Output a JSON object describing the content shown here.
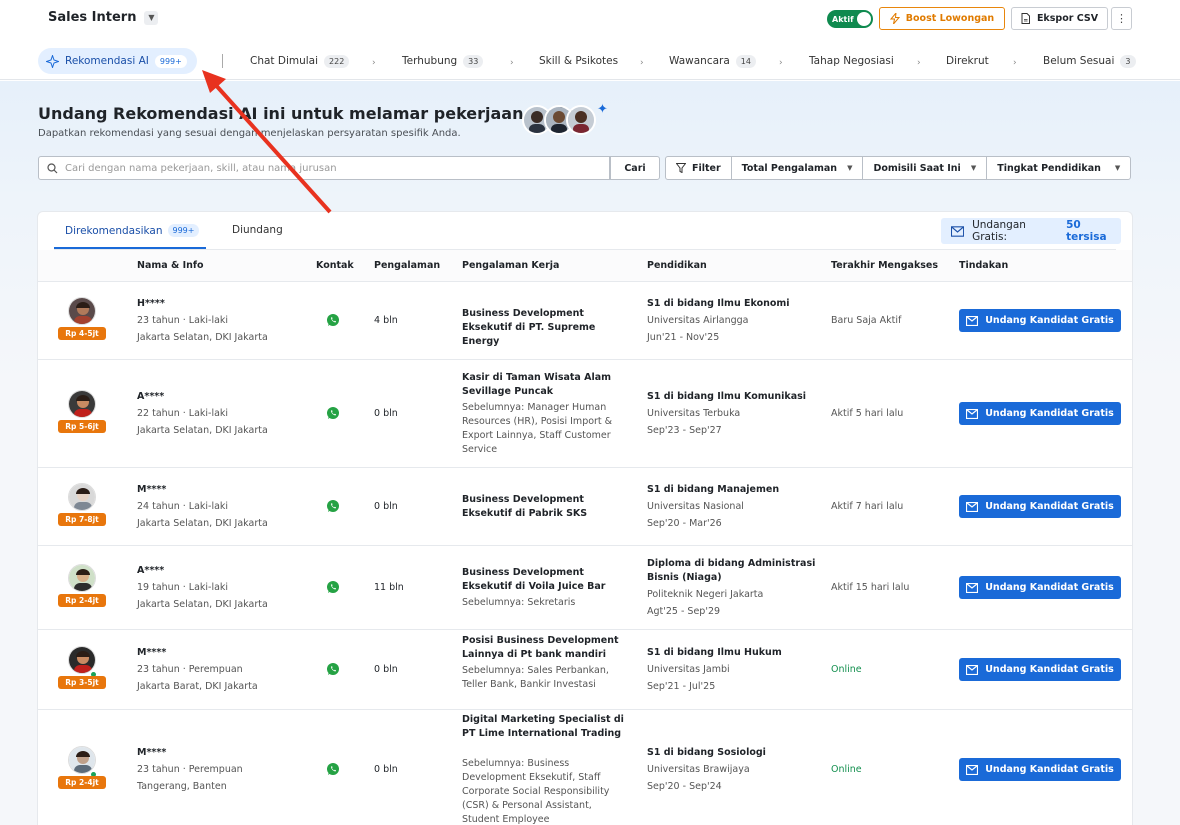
{
  "header": {
    "job_title": "Sales Intern",
    "status_label": "Aktif",
    "boost_label": "Boost Lowongan",
    "export_label": "Ekspor CSV"
  },
  "stages": [
    {
      "label": "Rekomendasi AI",
      "count": "999+"
    },
    {
      "label": "Chat Dimulai",
      "count": "222"
    },
    {
      "label": "Terhubung",
      "count": "33"
    },
    {
      "label": "Skill & Psikotes",
      "count": ""
    },
    {
      "label": "Wawancara",
      "count": "14"
    },
    {
      "label": "Tahap Negosiasi",
      "count": ""
    },
    {
      "label": "Direkrut",
      "count": ""
    },
    {
      "label": "Belum Sesuai",
      "count": "3"
    }
  ],
  "hero": {
    "title": "Undang Rekomendasi AI ini untuk melamar pekerjaan Anda",
    "subtitle": "Dapatkan rekomendasi yang sesuai dengan menjelaskan persyaratan spesifik Anda."
  },
  "search": {
    "placeholder": "Cari dengan nama pekerjaan, skill, atau nama jurusan",
    "button_label": "Cari"
  },
  "filters": [
    "Filter",
    "Total Pengalaman",
    "Domisili Saat Ini",
    "Tingkat Pendidikan"
  ],
  "card": {
    "tab_recommended": "Direkomendasikan",
    "tab_recommended_count": "999+",
    "tab_invited": "Diundang",
    "free_invites_label": "Undangan Gratis:",
    "free_invites_value": "50 tersisa"
  },
  "table": {
    "columns": [
      "Nama & Info",
      "Kontak",
      "Pengalaman",
      "Pengalaman Kerja",
      "Pendidikan",
      "Terakhir Mengakses",
      "Tindakan"
    ],
    "invite_label": "Undang Kandidat Gratis",
    "rows": [
      {
        "salary": "Rp 4-5jt",
        "name": "H****",
        "age_gender": "23 tahun · Laki-laki",
        "location": "Jakarta Selatan, DKI Jakarta",
        "experience": "4 bln",
        "job": "Business Development Eksekutif di PT. Supreme Energy",
        "previous": "",
        "edu_title": "S1 di bidang Ilmu Ekonomi",
        "edu_school": "Universitas Airlangga",
        "edu_period": "Jun'21 - Nov'25",
        "last_access": "Baru Saja Aktif",
        "online": false
      },
      {
        "salary": "Rp 5-6jt",
        "name": "A****",
        "age_gender": "22 tahun · Laki-laki",
        "location": "Jakarta Selatan, DKI Jakarta",
        "experience": "0 bln",
        "job": "Kasir di Taman Wisata Alam Sevillage Puncak",
        "previous": "Sebelumnya: Manager Human Resources (HR), Posisi Import & Export Lainnya, Staff Customer Service",
        "edu_title": "S1 di bidang Ilmu Komunikasi",
        "edu_school": "Universitas Terbuka",
        "edu_period": "Sep'23 - Sep'27",
        "last_access": "Aktif 5 hari lalu",
        "online": false
      },
      {
        "salary": "Rp 7-8jt",
        "name": "M****",
        "age_gender": "24 tahun · Laki-laki",
        "location": "Jakarta Selatan, DKI Jakarta",
        "experience": "0 bln",
        "job": "Business Development Eksekutif di Pabrik SKS",
        "previous": "",
        "edu_title": "S1 di bidang Manajemen",
        "edu_school": "Universitas Nasional",
        "edu_period": "Sep'20 - Mar'26",
        "last_access": "Aktif 7 hari lalu",
        "online": false
      },
      {
        "salary": "Rp 2-4jt",
        "name": "A****",
        "age_gender": "19 tahun · Laki-laki",
        "location": "Jakarta Selatan, DKI Jakarta",
        "experience": "11 bln",
        "job": "Business Development Eksekutif di Voila Juice Bar",
        "previous": "Sebelumnya: Sekretaris",
        "edu_title": "Diploma di bidang Administrasi Bisnis (Niaga)",
        "edu_school": "Politeknik Negeri Jakarta",
        "edu_period": "Agt'25 - Sep'29",
        "last_access": "Aktif 15 hari lalu",
        "online": false
      },
      {
        "salary": "Rp 3-5jt",
        "name": "M****",
        "age_gender": "23 tahun · Perempuan",
        "location": "Jakarta Barat, DKI Jakarta",
        "experience": "0 bln",
        "job": "Posisi Business Development Lainnya di Pt bank mandiri",
        "previous": "Sebelumnya: Sales Perbankan, Teller Bank, Bankir Investasi",
        "edu_title": "S1 di bidang Ilmu Hukum",
        "edu_school": "Universitas Jambi",
        "edu_period": "Sep'21 - Jul'25",
        "last_access": "Online",
        "online": true
      },
      {
        "salary": "Rp 2-4jt",
        "name": "M****",
        "age_gender": "23 tahun · Perempuan",
        "location": "Tangerang, Banten",
        "experience": "0 bln",
        "job": "Digital Marketing Specialist di PT Lime International Trading",
        "previous": "Sebelumnya: Business Development Eksekutif, Staff Corporate Social Responsibility (CSR) & Personal Assistant, Student Employee",
        "edu_title": "S1 di bidang Sosiologi",
        "edu_school": "Universitas Brawijaya",
        "edu_period": "Sep'20 - Sep'24",
        "last_access": "Online",
        "online": true
      }
    ]
  },
  "colors": {
    "primary": "#1a6ad8",
    "salary_badge": "#e8760c",
    "online": "#13904f",
    "boost": "#e07b00",
    "annotation_arrow": "#e8321f"
  },
  "icons": [
    "chevron-down-icon",
    "lightning-icon",
    "document-icon",
    "kebab-icon",
    "sparkle-icon",
    "search-icon",
    "filter-icon",
    "envelope-icon",
    "whatsapp-icon"
  ]
}
